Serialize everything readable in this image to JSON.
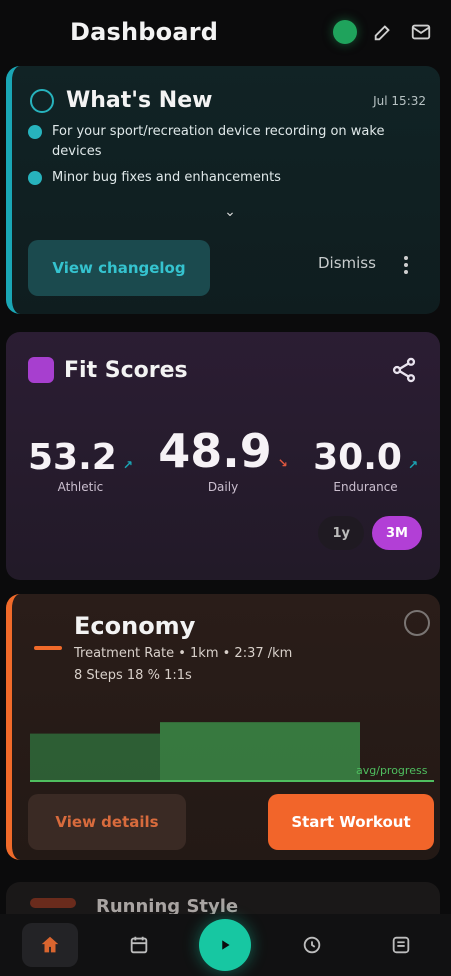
{
  "topbar": {
    "title": "Dashboard",
    "icons": [
      "status-dot",
      "edit-icon",
      "mail-icon"
    ]
  },
  "whats_new": {
    "title": "What's New",
    "date": "Jul 15:32",
    "bullets": [
      "For your sport/recreation device recording on wake devices",
      "Minor bug fixes and enhancements"
    ],
    "primary_button": "View changelog",
    "dismiss_label": "Dismiss",
    "accent_color": "#1aa6b5"
  },
  "fit_scores": {
    "title": "Fit Scores",
    "scores": [
      {
        "value": "53.2",
        "label": "Athletic"
      },
      {
        "value": "48.9",
        "label": "Daily"
      },
      {
        "value": "30.0",
        "label": "Endurance"
      }
    ],
    "toggle": {
      "option_a": "1y",
      "option_b": "3M"
    },
    "accent_color": "#a73fcf"
  },
  "economy": {
    "title": "Economy",
    "line1": "Treatment Rate • 1km • 2:37 /km",
    "line2": "8 Steps 18 % 1:1s",
    "chart_label": "avg/progress",
    "chart_bars": [
      0.55,
      0.68
    ],
    "buttons": {
      "details": "View details",
      "start": "Start Workout"
    },
    "accent_color": "#f06a2a"
  },
  "partial_card": {
    "text": "Running Style"
  },
  "bottom_nav": {
    "items": [
      "home-icon",
      "calendar-icon",
      "record-icon",
      "stats-icon",
      "profile-icon"
    ],
    "active_color": "#d9652f",
    "center_color": "#17c7a2"
  }
}
